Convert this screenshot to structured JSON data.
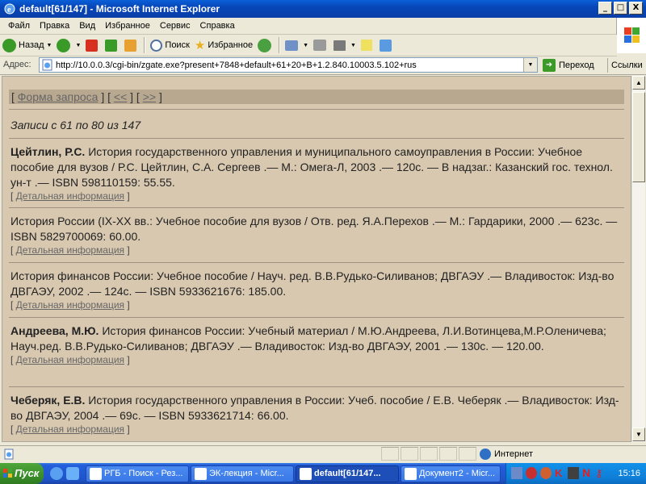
{
  "window": {
    "title": "default[61/147] - Microsoft Internet Explorer",
    "min": "_",
    "max": "□",
    "close": "X"
  },
  "menu": [
    "Файл",
    "Правка",
    "Вид",
    "Избранное",
    "Сервис",
    "Справка"
  ],
  "toolbar": {
    "back": "Назад",
    "search": "Поиск",
    "favorites": "Избранное"
  },
  "address": {
    "label": "Адрес:",
    "url": "http://10.0.0.3/cgi-bin/zgate.exe?present+7848+default+61+20+B+1.2.840.10003.5.102+rus",
    "go": "Переход",
    "links": "Ссылки"
  },
  "page": {
    "nav": {
      "open1": "[ ",
      "query_form": "Форма запроса",
      "sep1": " ] [ ",
      "prev": "<<",
      "sep2": " ] [ ",
      "next": ">>",
      "close": " ]"
    },
    "records_count": "Записи с 61 по 80 из 147",
    "detail_open": "[ ",
    "detail_label": "Детальная информация",
    "detail_close": " ]",
    "records": [
      {
        "author": "Цейтлин, Р.С.",
        "text": " История государственного управления и муниципального самоуправления в России: Учебное пособие для вузов / Р.С. Цейтлин, С.А. Сергеев .— М.: Омега-Л, 2003 .— 120с. — В надзаг.: Казанский гос. технол. ун-т .— ISBN 598110159: 55.55."
      },
      {
        "author": "",
        "text": "История России (IX-XX вв.: Учебное пособие для вузов / Отв. ред. Я.А.Перехов .— М.: Гардарики, 2000 .— 623с. — ISBN 5829700069: 60.00."
      },
      {
        "author": "",
        "text": "История финансов России: Учебное пособие / Науч. ред. В.В.Рудько-Силиванов; ДВГАЭУ .— Владивосток: Изд-во ДВГАЭУ, 2002 .— 124с. — ISBN 5933621676: 185.00."
      },
      {
        "author": "Андреева, М.Ю.",
        "text": " История финансов России: Учебный материал / М.Ю.Андреева, Л.И.Вотинцева,М.Р.Оленичева; Науч.ред. В.В.Рудько-Силиванов; ДВГАЭУ .— Владивосток: Изд-во ДВГАЭУ, 2001 .— 130с. — 120.00."
      },
      {
        "author": "Чеберяк, Е.В.",
        "text": " История государственного управления в России: Учеб. пособие / Е.В. Чеберяк .— Владивосток: Изд-во ДВГАЭУ, 2004 .— 69с. — ISBN 5933621714: 66.00."
      }
    ]
  },
  "status": {
    "zone": "Интернет"
  },
  "taskbar": {
    "start": "Пуск",
    "tasks": [
      "РГБ - Поиск - Рез...",
      "ЭК-лекция - Micr...",
      "default[61/147...",
      "Документ2 - Micr..."
    ],
    "clock": "15:16"
  }
}
